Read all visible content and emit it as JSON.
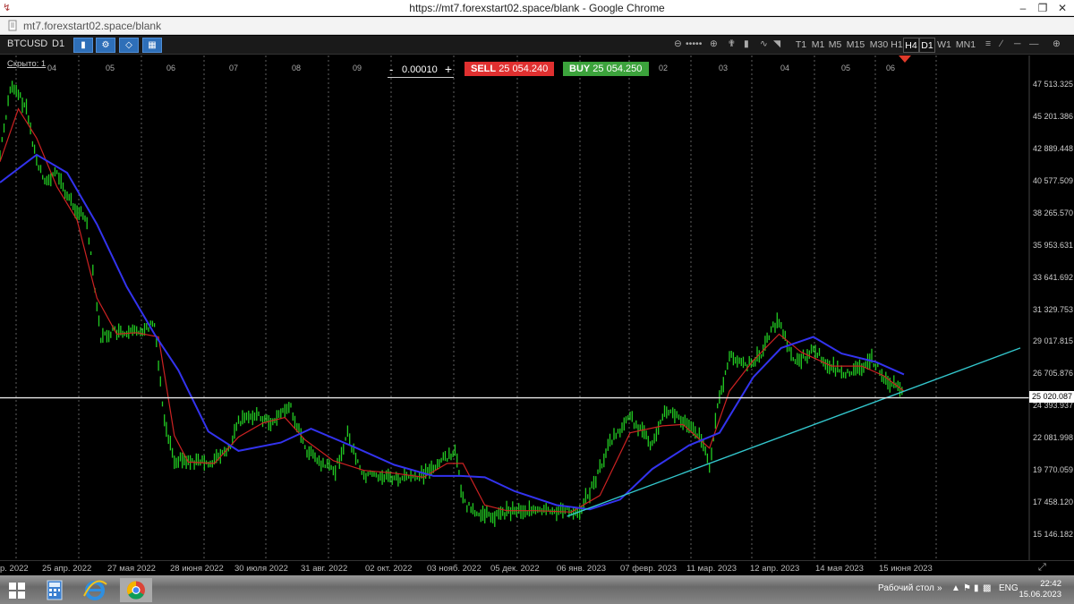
{
  "browser": {
    "title": "https://mt7.forexstart02.space/blank - Google Chrome",
    "url": "mt7.forexstart02.space/blank"
  },
  "toolbar": {
    "symbol": "BTCUSD",
    "period": "D1",
    "timeframes": [
      "T1",
      "M1",
      "M5",
      "M15",
      "M30",
      "H1",
      "H4",
      "D1",
      "W1",
      "MN1"
    ],
    "active_timeframes": [
      "H4",
      "D1"
    ]
  },
  "trade": {
    "hidden_label": "Скрыто: 1",
    "quantity": "0.00010",
    "minus": "-",
    "plus": "+",
    "sell_label": "SELL",
    "sell_price": "25 054.240",
    "buy_label": "BUY",
    "buy_price": "25 054.250",
    "sell_color": "#e03030",
    "buy_color": "#3ca33c"
  },
  "chart_data": {
    "type": "line",
    "symbol": "BTCUSD",
    "timeframe": "D1",
    "price_scale": [
      "47 513.325",
      "45 201.386",
      "42 889.448",
      "40 577.509",
      "38 265.570",
      "35 953.631",
      "33 641.692",
      "31 329.753",
      "29 017.815",
      "26 705.876",
      "24 393.937",
      "22 081.998",
      "19 770.059",
      "17 458.120",
      "15 146.182"
    ],
    "current_price": "25 020.087",
    "month_marks": [
      "04",
      "05",
      "06",
      "07",
      "08",
      "09",
      "02",
      "03",
      "04",
      "05",
      "06"
    ],
    "date_labels": [
      "р. 2022",
      "25 апр. 2022",
      "27 мая 2022",
      "28 июня 2022",
      "30 июля 2022",
      "31 авг. 2022",
      "02 окт. 2022",
      "03 нояб. 2022",
      "05 дек. 2022",
      "06 янв. 2023",
      "07 февр. 2023",
      "11 мар. 2023",
      "12 апр. 2023",
      "14 мая 2023",
      "15 июня 2023"
    ],
    "ylim": [
      15146.182,
      47513.325
    ],
    "series": [
      {
        "kind": "price",
        "color": "#22cc22",
        "x": [
          "2022-03-23",
          "2022-03-28",
          "2022-04-01",
          "2022-04-05",
          "2022-04-10",
          "2022-04-15",
          "2022-04-20",
          "2022-04-25",
          "2022-04-30",
          "2022-05-05",
          "2022-05-09",
          "2022-05-12",
          "2022-05-18",
          "2022-05-25",
          "2022-06-01",
          "2022-06-08",
          "2022-06-13",
          "2022-06-18",
          "2022-06-25",
          "2022-07-05",
          "2022-07-15",
          "2022-07-20",
          "2022-07-28",
          "2022-08-05",
          "2022-08-12",
          "2022-08-15",
          "2022-08-22",
          "2022-08-30",
          "2022-09-06",
          "2022-09-12",
          "2022-09-19",
          "2022-09-28",
          "2022-10-08",
          "2022-10-20",
          "2022-10-29",
          "2022-11-05",
          "2022-11-09",
          "2022-11-15",
          "2022-11-25",
          "2022-12-05",
          "2022-12-15",
          "2022-12-25",
          "2023-01-05",
          "2023-01-12",
          "2023-01-20",
          "2023-01-30",
          "2023-02-10",
          "2023-02-16",
          "2023-02-25",
          "2023-03-05",
          "2023-03-10",
          "2023-03-14",
          "2023-03-20",
          "2023-03-28",
          "2023-04-05",
          "2023-04-11",
          "2023-04-14",
          "2023-04-22",
          "2023-05-01",
          "2023-05-10",
          "2023-05-20",
          "2023-05-30",
          "2023-06-06",
          "2023-06-12",
          "2023-06-15"
        ],
        "y": [
          42500,
          47300,
          46800,
          45800,
          42000,
          40500,
          41200,
          39500,
          38500,
          37700,
          33000,
          29300,
          29800,
          29500,
          29900,
          30300,
          23400,
          20600,
          20500,
          20300,
          21200,
          23200,
          23900,
          23200,
          24200,
          24300,
          21400,
          20200,
          19800,
          22400,
          19500,
          19400,
          19200,
          19500,
          20500,
          21200,
          17600,
          16700,
          16500,
          17000,
          16800,
          16900,
          16900,
          18800,
          21800,
          23600,
          21600,
          24300,
          23300,
          22300,
          20200,
          24200,
          28000,
          27300,
          28200,
          30200,
          30400,
          27500,
          28500,
          27200,
          26700,
          27800,
          26300,
          25900,
          25000
        ]
      },
      {
        "kind": "fast-ma",
        "color": "#cc2222",
        "x": [
          "2022-03-23",
          "2022-04-01",
          "2022-04-10",
          "2022-04-20",
          "2022-04-30",
          "2022-05-10",
          "2022-05-20",
          "2022-05-30",
          "2022-06-10",
          "2022-06-18",
          "2022-06-25",
          "2022-07-08",
          "2022-07-20",
          "2022-08-01",
          "2022-08-12",
          "2022-08-22",
          "2022-09-05",
          "2022-09-20",
          "2022-10-05",
          "2022-10-20",
          "2022-11-01",
          "2022-11-09",
          "2022-11-20",
          "2022-12-01",
          "2022-12-15",
          "2023-01-01",
          "2023-01-15",
          "2023-01-30",
          "2023-02-15",
          "2023-02-25",
          "2023-03-10",
          "2023-03-20",
          "2023-04-01",
          "2023-04-14",
          "2023-04-25",
          "2023-05-10",
          "2023-05-25",
          "2023-06-05",
          "2023-06-15"
        ],
        "y": [
          42000,
          45800,
          43700,
          40200,
          37800,
          32200,
          29600,
          29700,
          29400,
          22300,
          20400,
          20300,
          22200,
          23200,
          23600,
          22000,
          20500,
          19800,
          19600,
          19300,
          20300,
          20300,
          17300,
          16900,
          16900,
          16800,
          18000,
          22500,
          23000,
          23100,
          21400,
          25500,
          27700,
          29600,
          28300,
          27300,
          27300,
          26600,
          25500
        ]
      },
      {
        "kind": "slow-ma",
        "color": "#3333ee",
        "x": [
          "2022-03-23",
          "2022-04-10",
          "2022-04-25",
          "2022-05-10",
          "2022-05-25",
          "2022-06-08",
          "2022-06-20",
          "2022-07-05",
          "2022-07-20",
          "2022-08-10",
          "2022-08-25",
          "2022-09-15",
          "2022-10-05",
          "2022-10-25",
          "2022-11-08",
          "2022-11-20",
          "2022-12-05",
          "2022-12-25",
          "2023-01-10",
          "2023-01-25",
          "2023-02-10",
          "2023-02-28",
          "2023-03-15",
          "2023-04-01",
          "2023-04-15",
          "2023-05-01",
          "2023-05-15",
          "2023-06-01",
          "2023-06-15"
        ],
        "y": [
          40500,
          42500,
          41200,
          37500,
          33000,
          29600,
          27000,
          22600,
          21200,
          21800,
          22800,
          21500,
          20200,
          19400,
          19400,
          19300,
          18300,
          17300,
          17000,
          17700,
          19900,
          21600,
          22500,
          26500,
          28600,
          29400,
          28200,
          27600,
          26700
        ]
      },
      {
        "kind": "trendline",
        "color": "#33c6cc",
        "x": [
          "2022-12-30",
          "2023-07-20"
        ],
        "y": [
          16500,
          28600
        ]
      }
    ]
  },
  "taskbar": {
    "desktop_label": "Рабочий стол",
    "lang": "ENG",
    "time": "22:42",
    "date": "15.06.2023"
  }
}
